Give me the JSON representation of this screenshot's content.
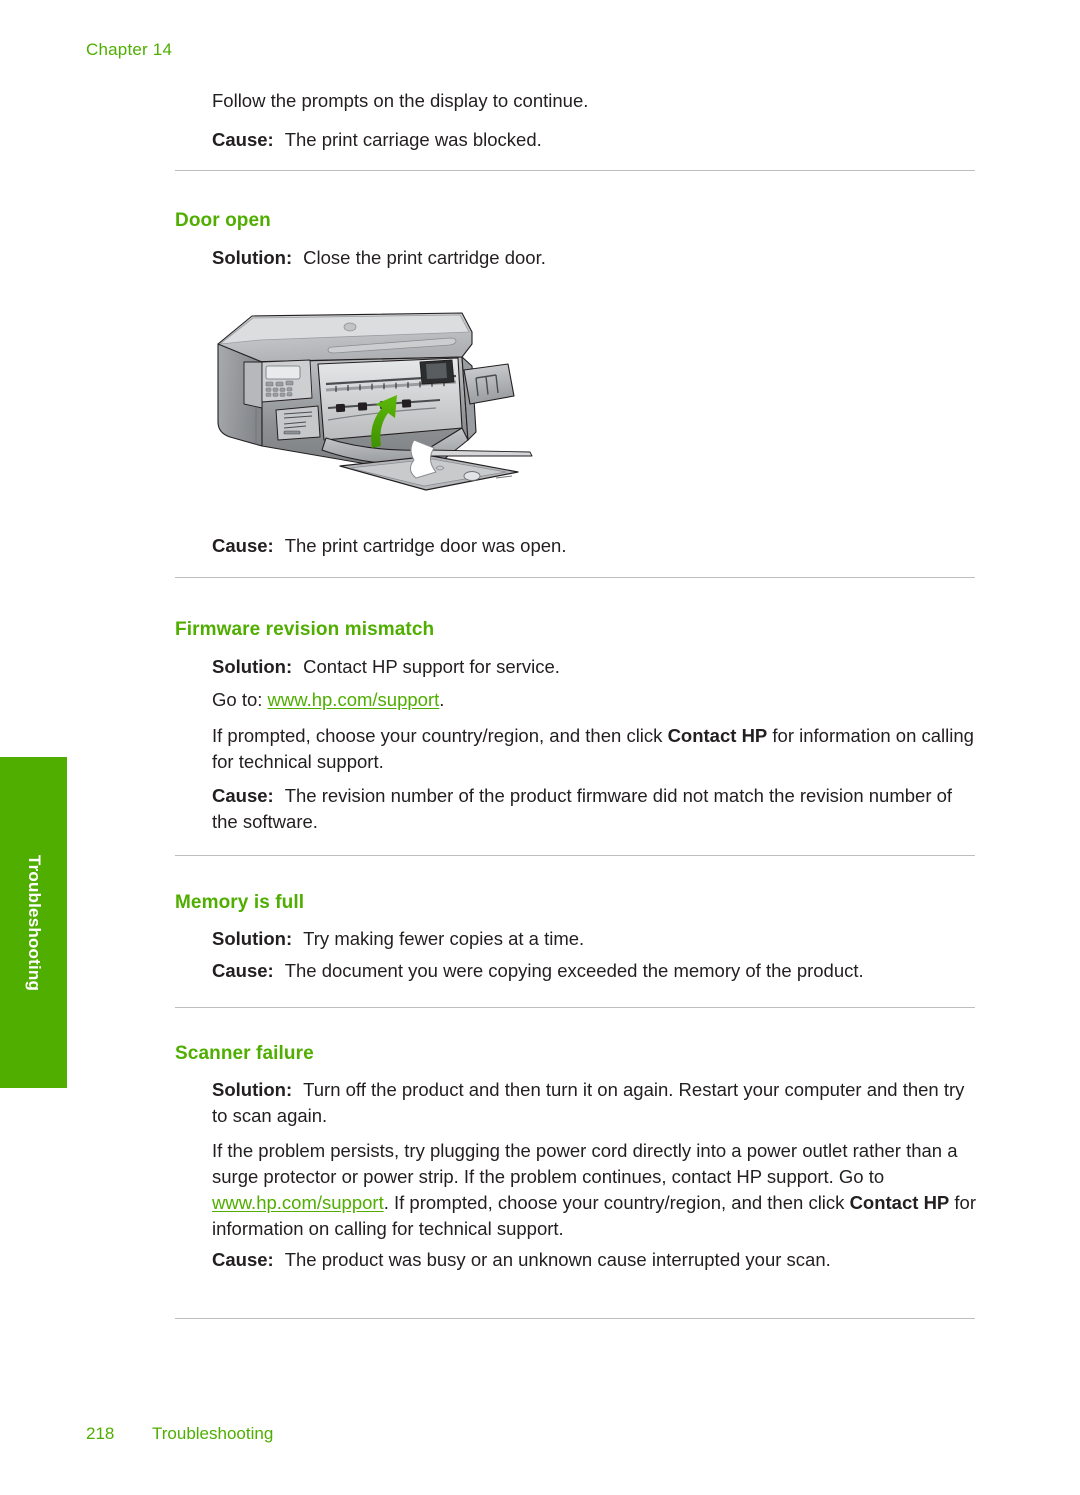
{
  "header": {
    "chapter_label": "Chapter 14"
  },
  "side_tab": {
    "label": "Troubleshooting",
    "color": "#4FAE00"
  },
  "intro": {
    "follow_prompts": "Follow the prompts on the display to continue.",
    "cause_label": "Cause:",
    "cause_text": "The print carriage was blocked."
  },
  "sections": [
    {
      "title": "Door open",
      "solution_label": "Solution:",
      "solution_text": "Close the print cartridge door.",
      "cause_label": "Cause:",
      "cause_text": "The print cartridge door was open.",
      "figure": {
        "alt": "HP All-in-One printer with the print cartridge door open and a green arrow showing the door closing upward",
        "arrow_color": "#4FAE00"
      }
    },
    {
      "title": "Firmware revision mismatch",
      "solution_label": "Solution:",
      "solution_text": "Contact HP support for service.",
      "goto_prefix": "Go to:",
      "goto_link": "www.hp.com/support",
      "goto_suffix": ".",
      "prompt_text_1": "If prompted, choose your country/region, and then click ",
      "prompt_bold": "Contact HP",
      "prompt_text_2": " for information on calling for technical support.",
      "cause_label": "Cause:",
      "cause_text": "The revision number of the product firmware did not match the revision number of the software."
    },
    {
      "title": "Memory is full",
      "solution_label": "Solution:",
      "solution_text": "Try making fewer copies at a time.",
      "cause_label": "Cause:",
      "cause_text": "The document you were copying exceeded the memory of the product."
    },
    {
      "title": "Scanner failure",
      "solution_label": "Solution:",
      "solution_text": "Turn off the product and then turn it on again. Restart your computer and then try to scan again.",
      "persist_text_1": "If the problem persists, try plugging the power cord directly into a power outlet rather than a surge protector or power strip. If the problem continues, contact HP support. Go to ",
      "persist_link": "www.hp.com/support",
      "persist_text_2": ". If prompted, choose your country/region, and then click ",
      "persist_bold": "Contact HP",
      "persist_text_3": " for information on calling for technical support.",
      "cause_label": "Cause:",
      "cause_text": "The product was busy or an unknown cause interrupted your scan."
    }
  ],
  "footer": {
    "page_number": "218",
    "section_name": "Troubleshooting"
  }
}
